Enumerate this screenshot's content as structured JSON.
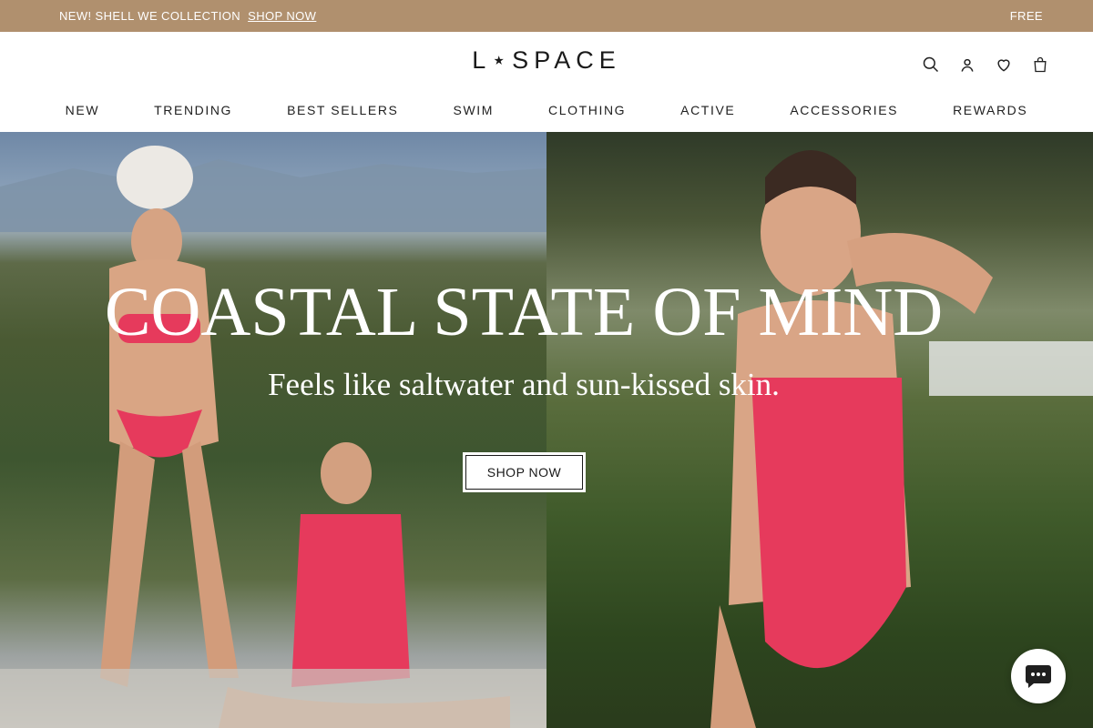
{
  "announcement": {
    "left_text": "NEW! SHELL WE COLLECTION",
    "left_link": "SHOP NOW",
    "right_text": "FREE"
  },
  "header": {
    "logo": "L⋆SPACE",
    "icons": [
      "search-icon",
      "account-icon",
      "wishlist-icon",
      "cart-icon"
    ]
  },
  "nav": {
    "items": [
      "NEW",
      "TRENDING",
      "BEST SELLERS",
      "SWIM",
      "CLOTHING",
      "ACTIVE",
      "ACCESSORIES",
      "REWARDS"
    ]
  },
  "hero": {
    "title": "COASTAL STATE OF MIND",
    "subtitle": "Feels like saltwater and sun-kissed skin.",
    "cta": "SHOP NOW"
  },
  "colors": {
    "announcement_bg": "#b0906e",
    "swimsuit": "#e63a5c"
  }
}
